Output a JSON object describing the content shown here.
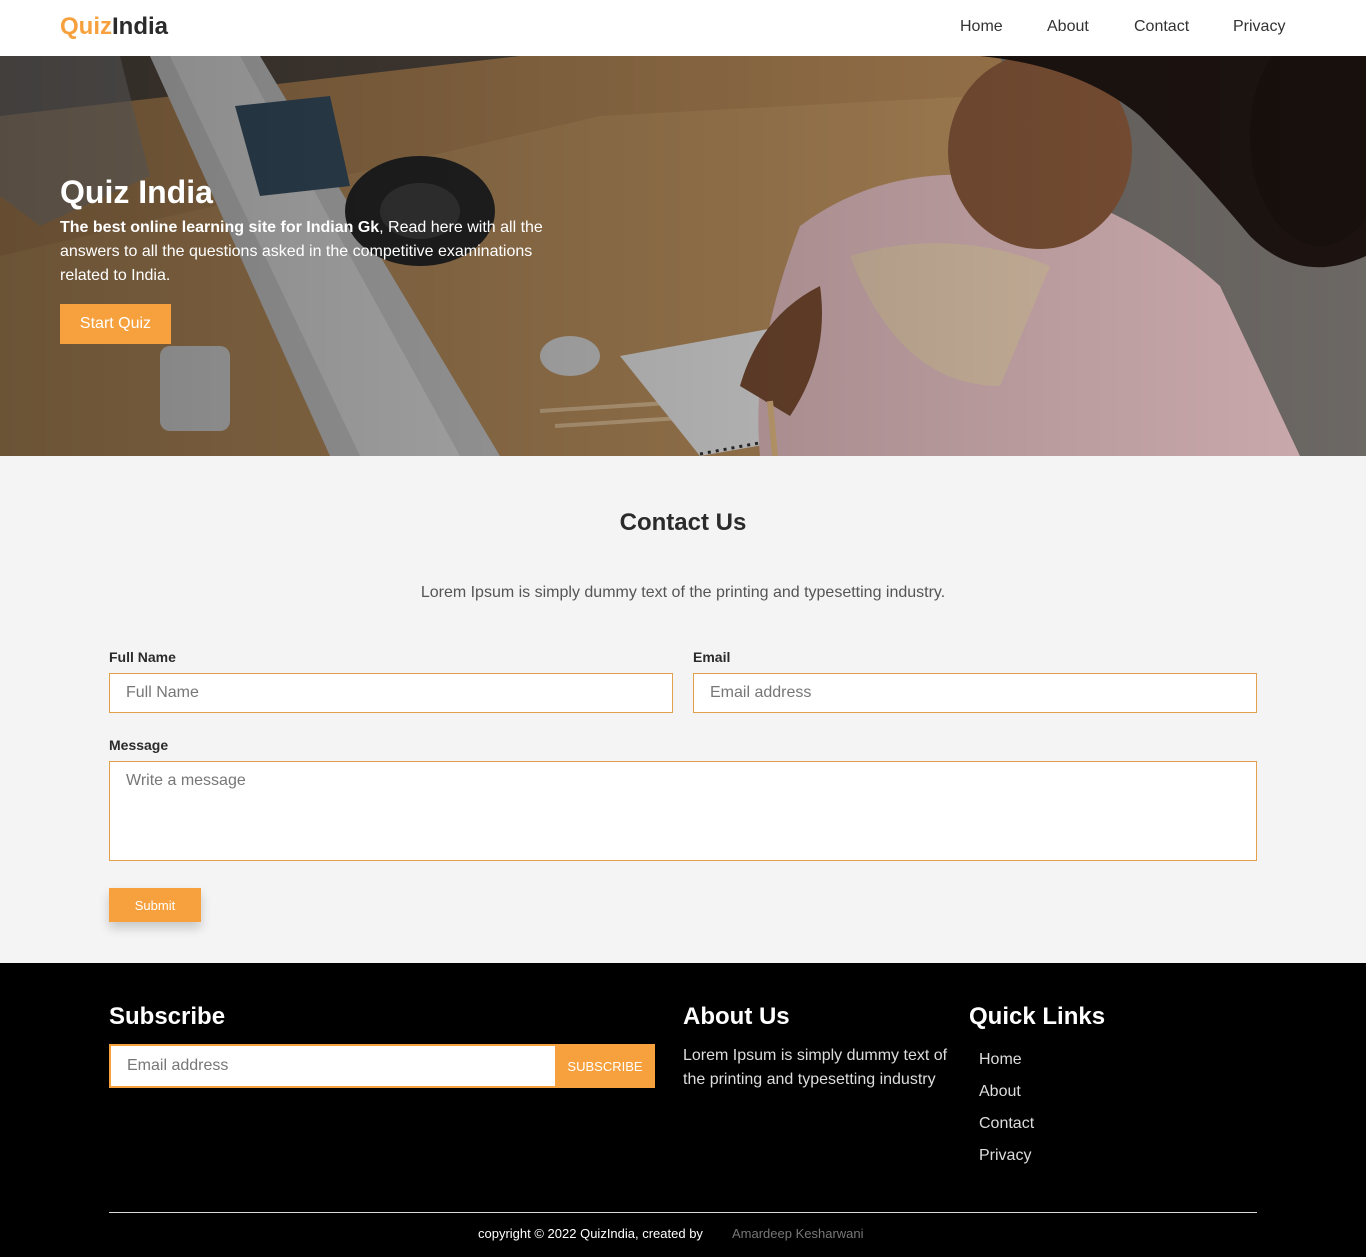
{
  "navbar": {
    "logo_part1": "Quiz",
    "logo_part2": "India",
    "links": [
      "Home",
      "About",
      "Contact",
      "Privacy"
    ]
  },
  "hero": {
    "title": "Quiz India",
    "desc_bold": "The best online learning site for Indian Gk",
    "desc_rest": ", Read here with all the answers to all the questions asked in the competitive examinations related to India.",
    "cta": "Start Quiz"
  },
  "contact": {
    "title": "Contact Us",
    "subtitle": "Lorem Ipsum is simply dummy text of the printing and typesetting industry.",
    "name_label": "Full Name",
    "name_placeholder": "Full Name",
    "email_label": "Email",
    "email_placeholder": "Email address",
    "message_label": "Message",
    "message_placeholder": "Write a message",
    "submit": "Submit"
  },
  "footer": {
    "subscribe_title": "Subscribe",
    "subscribe_placeholder": "Email address",
    "subscribe_button": "SUBSCRIBE",
    "about_title": "About Us",
    "about_text": "Lorem Ipsum is simply dummy text of the printing and typesetting industry",
    "quicklinks_title": "Quick Links",
    "quicklinks": [
      "Home",
      "About",
      "Contact",
      "Privacy"
    ],
    "copyright": "copyright © 2022 QuizIndia, created by",
    "author": "Amardeep Kesharwani"
  },
  "colors": {
    "accent": "#f7a13e",
    "footer_bg": "#000000",
    "section_bg": "#f4f4f4"
  }
}
